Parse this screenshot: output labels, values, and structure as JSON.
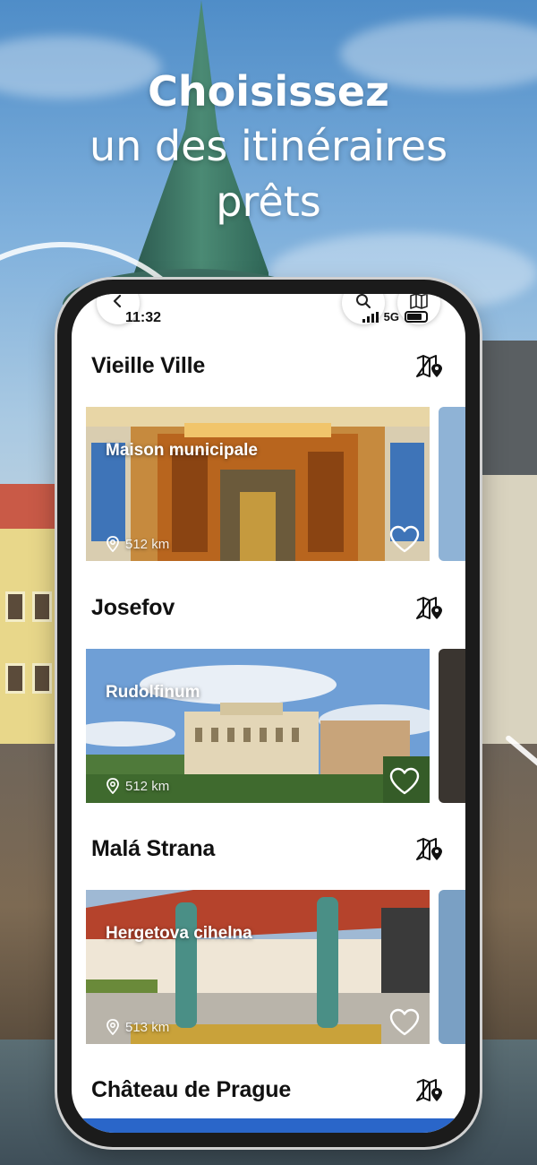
{
  "headline": {
    "line1": "Choisissez",
    "line2": "un des itinéraires",
    "line3": "prêts"
  },
  "status_bar": {
    "time": "11:32",
    "network": "5G"
  },
  "icons": {
    "back": "back-arrow-icon",
    "search": "search-icon",
    "map": "map-icon",
    "route_map": "map-pin-icon",
    "location": "location-pin-icon",
    "favorite": "heart-icon"
  },
  "sections": [
    {
      "title": "Vieille Ville",
      "card": {
        "name": "Maison municipale",
        "distance": "512 km"
      }
    },
    {
      "title": "Josefov",
      "card": {
        "name": "Rudolfinum",
        "distance": "512 km"
      }
    },
    {
      "title": "Malá Strana",
      "card": {
        "name": "Hergetova cihelna",
        "distance": "513 km"
      }
    },
    {
      "title": "Château de Prague"
    }
  ],
  "colors": {
    "accent": "#2a66c9",
    "text": "#111111"
  }
}
